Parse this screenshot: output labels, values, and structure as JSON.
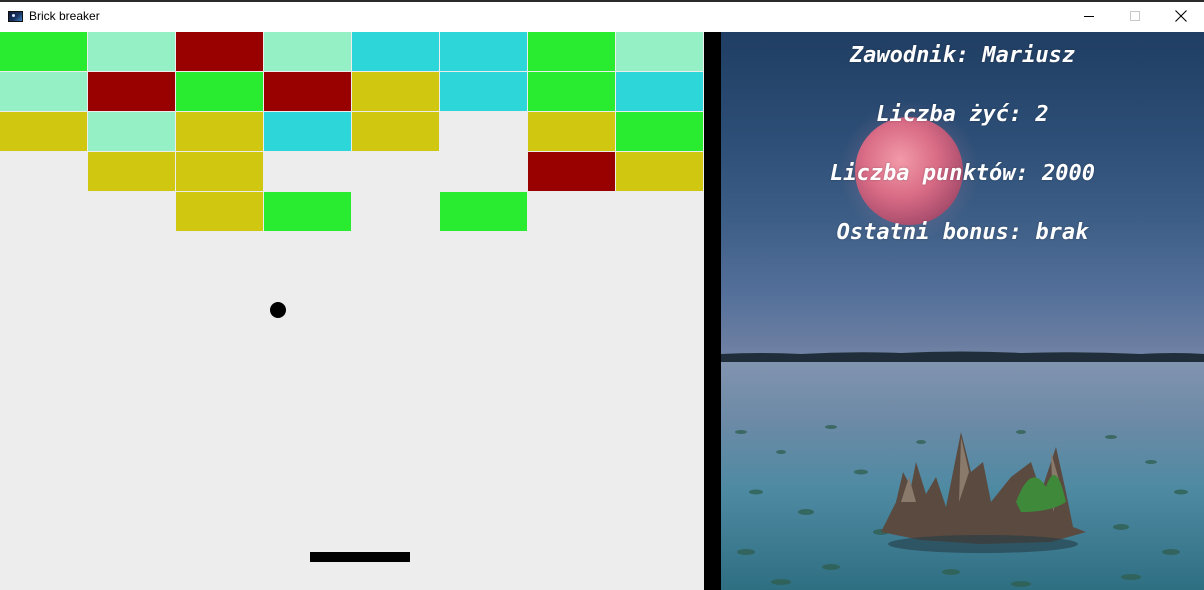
{
  "window": {
    "title": "Brick breaker",
    "app_icon": "game-icon",
    "controls": {
      "minimize_icon": "minimize-icon",
      "maximize_icon": "maximize-icon",
      "close_icon": "close-icon"
    }
  },
  "game": {
    "background_color": "#ededed",
    "brick_colors": {
      "G": "#29eb2f",
      "M": "#96f0c6",
      "R": "#990000",
      "C": "#2dd6d9",
      "Y": "#d0c810"
    },
    "brick_grid": [
      [
        "G",
        "M",
        "R",
        "M",
        "C",
        "C",
        "G",
        "M"
      ],
      [
        "M",
        "R",
        "G",
        "R",
        "Y",
        "C",
        "G",
        "C"
      ],
      [
        "Y",
        "M",
        "Y",
        "C",
        "Y",
        "",
        "Y",
        "G"
      ],
      [
        "",
        "Y",
        "Y",
        "",
        "",
        "",
        "R",
        "Y"
      ],
      [
        "",
        "",
        "Y",
        "G",
        "",
        "G",
        "",
        ""
      ]
    ],
    "ball_color": "#000000",
    "paddle_color": "#000000"
  },
  "info": {
    "player": "Zawodnik: Mariusz",
    "lives": "Liczba żyć: 2",
    "points": "Liczba punktów: 2000",
    "bonus": "Ostatni bonus: brak"
  }
}
